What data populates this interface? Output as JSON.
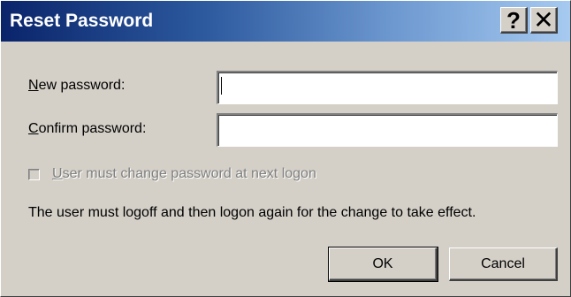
{
  "window": {
    "title": "Reset Password"
  },
  "titlebar_buttons": {
    "help_label": "?",
    "close_label": "✕"
  },
  "fields": {
    "new_password": {
      "label_first": "N",
      "label_rest": "ew password:",
      "value": ""
    },
    "confirm_password": {
      "label_first": "C",
      "label_rest": "onfirm password:",
      "value": ""
    }
  },
  "checkbox": {
    "label_first": "U",
    "label_rest": "ser must change password at next logon",
    "checked": false,
    "disabled": true
  },
  "info": {
    "text": "The user must logoff and then logon again for the change to take effect."
  },
  "buttons": {
    "ok_label": "OK",
    "cancel_label": "Cancel"
  },
  "colors": {
    "titlebar_start": "#0a246a",
    "titlebar_end": "#a6caf0",
    "dialog_face": "#d4d0c8",
    "disabled_text": "#808080"
  },
  "icons": {
    "help": "question-mark-icon",
    "close": "close-icon"
  }
}
